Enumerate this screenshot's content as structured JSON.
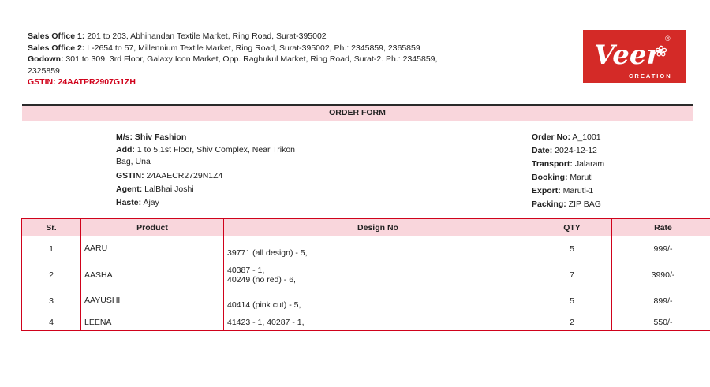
{
  "header": {
    "sales_office_1_label": "Sales Office 1:",
    "sales_office_1": " 201 to 203, Abhinandan Textile Market, Ring Road, Surat-395002",
    "sales_office_2_label": "Sales Office 2:",
    "sales_office_2": " L-2654 to 57, Millennium Textile Market, Ring Road, Surat-395002, Ph.: 2345859, 2365859",
    "godown_label": "Godown:",
    "godown": " 301 to 309, 3rd Floor, Galaxy Icon Market, Opp. Raghukul Market, Ring Road, Surat-2. Ph.: 2345859, 2325859",
    "gstin": "GSTIN: 24AATPR2907G1ZH"
  },
  "logo": {
    "brand": "Veer",
    "tagline": "CREATION",
    "reg": "®",
    "bg_color": "#d42a27"
  },
  "form_title": "ORDER FORM",
  "party": {
    "ms_label": "M/s:",
    "ms": " Shiv Fashion",
    "add_label": "Add:",
    "add": " 1 to 5,1st Floor, Shiv Complex, Near Trikon Bag, Una",
    "gstin_label": "GSTIN:",
    "gstin": " 24AAECR2729N1Z4",
    "agent_label": "Agent:",
    "agent": " LalBhai Joshi",
    "haste_label": "Haste:",
    "haste": " Ajay"
  },
  "order": {
    "no_label": "Order No:",
    "no": " A_1001",
    "date_label": "Date:",
    "date": " 2024-12-12",
    "transport_label": "Transport:",
    "transport": " Jalaram",
    "booking_label": "Booking:",
    "booking": " Maruti",
    "export_label": "Export:",
    "export": " Maruti-1",
    "packing_label": "Packing:",
    "packing": " ZIP BAG"
  },
  "table": {
    "headers": [
      "Sr.",
      "Product",
      "Design No",
      "QTY",
      "Rate"
    ],
    "rows": [
      {
        "sr": "1",
        "product": "AARU",
        "design": "39771 (all design) - 5,",
        "qty": "5",
        "rate": "999/-"
      },
      {
        "sr": "2",
        "product": "AASHA",
        "design": "40387 - 1,\n40249 (no red) - 6,",
        "qty": "7",
        "rate": "3990/-"
      },
      {
        "sr": "3",
        "product": "AAYUSHI",
        "design": "40414 (pink cut) - 5,",
        "qty": "5",
        "rate": "899/-"
      },
      {
        "sr": "4",
        "product": "LEENA",
        "design": "41423 - 1, 40287 - 1,",
        "qty": "2",
        "rate": "550/-"
      }
    ]
  },
  "colors": {
    "accent_red": "#d0021b",
    "pink_band": "#f9d6dc"
  }
}
